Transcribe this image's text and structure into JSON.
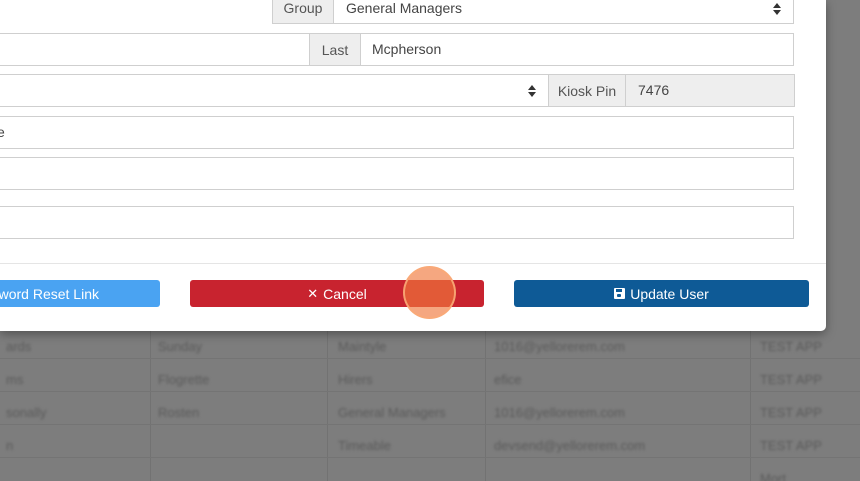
{
  "form": {
    "group_label": "Group",
    "group_value": "General Managers",
    "last_label": "Last",
    "last_value": "Mcpherson",
    "kiosk_pin_label": "Kiosk Pin",
    "kiosk_pin_value": "7476",
    "partial_field_value": "e"
  },
  "footer": {
    "reset_label": "ssword Reset Link",
    "cancel_label": "Cancel",
    "cancel_icon": "✕",
    "update_label": "Update User"
  },
  "background_table": {
    "rows": [
      [
        "ards",
        "Sunday",
        "Maintyle",
        "1016@yellorerem.com",
        "TEST APP"
      ],
      [
        "ms",
        "Flogrette",
        "Hirers",
        "efice",
        "TEST APP"
      ],
      [
        "sonally",
        "Rosten",
        "General Managers",
        "1016@yellorerem.com",
        "TEST APP"
      ],
      [
        "n",
        "",
        "Timeable",
        "devsend@yellorerem.com",
        "TEST APP"
      ],
      [
        "",
        "",
        "",
        "",
        "Mort"
      ]
    ]
  }
}
